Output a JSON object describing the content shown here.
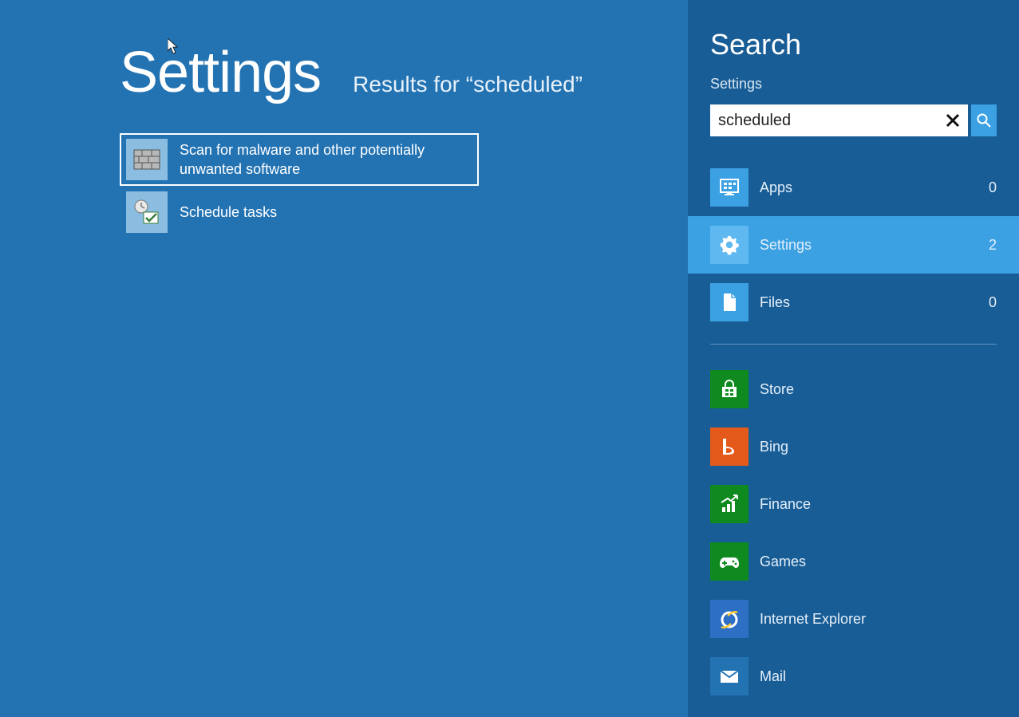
{
  "main": {
    "title": "Settings",
    "subtitle_prefix": "Results for “",
    "subtitle_query": "scheduled",
    "subtitle_suffix": "”",
    "results": [
      {
        "label": "Scan for malware and other potentially unwanted software",
        "icon": "firewall-icon",
        "selected": true
      },
      {
        "label": "Schedule tasks",
        "icon": "task-scheduler-icon",
        "selected": false
      }
    ]
  },
  "sidebar": {
    "title": "Search",
    "scope_label": "Settings",
    "query": "scheduled",
    "scopes": [
      {
        "label": "Apps",
        "count": 0,
        "icon": "apps-icon",
        "active": false
      },
      {
        "label": "Settings",
        "count": 2,
        "icon": "gear-icon",
        "active": true
      },
      {
        "label": "Files",
        "count": 0,
        "icon": "file-icon",
        "active": false
      }
    ],
    "apps": [
      {
        "label": "Store",
        "icon": "store-icon",
        "bg": "#0f8a1e"
      },
      {
        "label": "Bing",
        "icon": "bing-icon",
        "bg": "#e45a1b"
      },
      {
        "label": "Finance",
        "icon": "finance-icon",
        "bg": "#0f8a1e"
      },
      {
        "label": "Games",
        "icon": "games-icon",
        "bg": "#0f8a1e"
      },
      {
        "label": "Internet Explorer",
        "icon": "ie-icon",
        "bg": "#2e6fc6"
      },
      {
        "label": "Mail",
        "icon": "mail-icon",
        "bg": "#2373b3"
      }
    ]
  }
}
